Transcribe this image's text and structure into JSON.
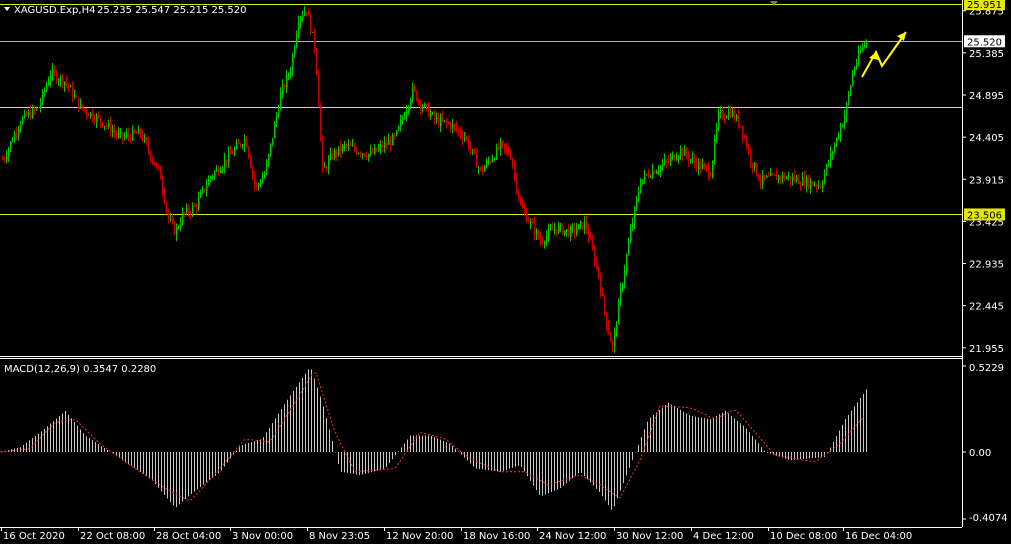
{
  "header": {
    "symbol_tf": "XAGUSD.Exp,H4",
    "ohlc": "25.235 25.547 25.215 25.520"
  },
  "indicator": {
    "label": "MACD(12,26,9) 0.3547 0.2280"
  },
  "price_axis": {
    "ticks": [
      "25.875",
      "25.385",
      "24.895",
      "24.405",
      "23.915",
      "23.425",
      "22.935",
      "22.445",
      "21.955"
    ],
    "highlight_labels": [
      {
        "text": "25.951",
        "style": "yellow"
      },
      {
        "text": "25.520",
        "style": "white"
      },
      {
        "text": "23.506",
        "style": "yellow"
      }
    ]
  },
  "macd_axis": {
    "ticks": [
      "0.5229",
      "0.00",
      "-0.4074"
    ]
  },
  "time_axis": {
    "labels": [
      "16 Oct 2020",
      "22 Oct 08:00",
      "28 Oct 04:00",
      "3 Nov 00:00",
      "8 Nov 23:05",
      "12 Nov 20:00",
      "18 Nov 16:00",
      "24 Nov 12:00",
      "30 Nov 12:00",
      "4 Dec 12:00",
      "10 Dec 08:00",
      "16 Dec 04:00"
    ]
  },
  "horizontal_levels": [
    25.951,
    25.52,
    24.75,
    23.506
  ],
  "colors": {
    "background": "#000000",
    "bull_candle": "#00c800",
    "bear_candle": "#c80000",
    "level_line": "#e6e600",
    "current_line": "#b0b0b0",
    "macd_hist": "#c8c8c8",
    "signal_line": "#ff3030",
    "arrow": "#ffff00",
    "axis": "#ffffff"
  },
  "chart_data": {
    "type": "candlestick",
    "price_range": [
      21.86,
      26.0
    ],
    "macd_range": [
      -0.4074,
      0.5229
    ],
    "anchors": [
      [
        3,
        24.15
      ],
      [
        20,
        24.6
      ],
      [
        38,
        24.75
      ],
      [
        50,
        25.15
      ],
      [
        65,
        25.05
      ],
      [
        80,
        24.75
      ],
      [
        100,
        24.6
      ],
      [
        120,
        24.4
      ],
      [
        140,
        24.45
      ],
      [
        160,
        23.95
      ],
      [
        168,
        23.45
      ],
      [
        175,
        23.3
      ],
      [
        182,
        23.5
      ],
      [
        195,
        23.6
      ],
      [
        210,
        23.95
      ],
      [
        230,
        24.2
      ],
      [
        245,
        24.4
      ],
      [
        255,
        23.8
      ],
      [
        265,
        24.0
      ],
      [
        280,
        24.9
      ],
      [
        290,
        25.2
      ],
      [
        298,
        25.8
      ],
      [
        306,
        25.9
      ],
      [
        315,
        25.4
      ],
      [
        322,
        24.0
      ],
      [
        332,
        24.2
      ],
      [
        345,
        24.3
      ],
      [
        370,
        24.2
      ],
      [
        395,
        24.4
      ],
      [
        412,
        24.95
      ],
      [
        420,
        24.8
      ],
      [
        435,
        24.6
      ],
      [
        450,
        24.55
      ],
      [
        465,
        24.4
      ],
      [
        480,
        24.0
      ],
      [
        500,
        24.3
      ],
      [
        510,
        24.2
      ],
      [
        520,
        23.6
      ],
      [
        530,
        23.4
      ],
      [
        540,
        23.2
      ],
      [
        555,
        23.35
      ],
      [
        570,
        23.3
      ],
      [
        585,
        23.4
      ],
      [
        598,
        22.8
      ],
      [
        605,
        22.3
      ],
      [
        612,
        21.95
      ],
      [
        620,
        22.6
      ],
      [
        630,
        23.3
      ],
      [
        640,
        23.9
      ],
      [
        650,
        24.0
      ],
      [
        665,
        24.1
      ],
      [
        680,
        24.25
      ],
      [
        695,
        24.1
      ],
      [
        710,
        24.0
      ],
      [
        718,
        24.65
      ],
      [
        730,
        24.7
      ],
      [
        740,
        24.55
      ],
      [
        750,
        24.15
      ],
      [
        760,
        23.9
      ],
      [
        780,
        23.95
      ],
      [
        800,
        23.9
      ],
      [
        820,
        23.85
      ],
      [
        835,
        24.35
      ],
      [
        845,
        24.7
      ],
      [
        853,
        25.2
      ],
      [
        862,
        25.45
      ],
      [
        866,
        25.52
      ]
    ],
    "macd_anchors": [
      [
        0,
        0.0
      ],
      [
        20,
        0.03
      ],
      [
        40,
        0.12
      ],
      [
        65,
        0.25
      ],
      [
        85,
        0.1
      ],
      [
        110,
        0.0
      ],
      [
        130,
        -0.08
      ],
      [
        150,
        -0.16
      ],
      [
        175,
        -0.34
      ],
      [
        190,
        -0.26
      ],
      [
        220,
        -0.12
      ],
      [
        240,
        0.04
      ],
      [
        262,
        0.08
      ],
      [
        285,
        0.3
      ],
      [
        310,
        0.52
      ],
      [
        322,
        0.3
      ],
      [
        340,
        -0.12
      ],
      [
        360,
        -0.14
      ],
      [
        385,
        -0.1
      ],
      [
        410,
        0.1
      ],
      [
        430,
        0.1
      ],
      [
        450,
        0.05
      ],
      [
        475,
        -0.1
      ],
      [
        500,
        -0.12
      ],
      [
        520,
        -0.08
      ],
      [
        540,
        -0.27
      ],
      [
        560,
        -0.22
      ],
      [
        580,
        -0.12
      ],
      [
        600,
        -0.25
      ],
      [
        612,
        -0.36
      ],
      [
        630,
        -0.08
      ],
      [
        648,
        0.2
      ],
      [
        668,
        0.3
      ],
      [
        690,
        0.22
      ],
      [
        710,
        0.2
      ],
      [
        725,
        0.25
      ],
      [
        745,
        0.15
      ],
      [
        765,
        0.0
      ],
      [
        790,
        -0.05
      ],
      [
        825,
        -0.03
      ],
      [
        845,
        0.2
      ],
      [
        866,
        0.38
      ]
    ],
    "signal_anchors": [
      [
        0,
        0.0
      ],
      [
        30,
        0.02
      ],
      [
        55,
        0.18
      ],
      [
        75,
        0.2
      ],
      [
        100,
        0.05
      ],
      [
        130,
        -0.08
      ],
      [
        165,
        -0.22
      ],
      [
        190,
        -0.3
      ],
      [
        220,
        -0.1
      ],
      [
        245,
        0.08
      ],
      [
        270,
        0.06
      ],
      [
        300,
        0.35
      ],
      [
        315,
        0.5
      ],
      [
        335,
        0.12
      ],
      [
        355,
        -0.12
      ],
      [
        395,
        -0.1
      ],
      [
        420,
        0.12
      ],
      [
        445,
        0.08
      ],
      [
        470,
        -0.04
      ],
      [
        500,
        -0.12
      ],
      [
        525,
        -0.12
      ],
      [
        548,
        -0.2
      ],
      [
        580,
        -0.14
      ],
      [
        600,
        -0.2
      ],
      [
        620,
        -0.28
      ],
      [
        640,
        -0.05
      ],
      [
        660,
        0.28
      ],
      [
        690,
        0.27
      ],
      [
        715,
        0.2
      ],
      [
        735,
        0.26
      ],
      [
        758,
        0.1
      ],
      [
        775,
        -0.02
      ],
      [
        815,
        -0.06
      ],
      [
        840,
        0.05
      ],
      [
        866,
        0.23
      ]
    ]
  }
}
